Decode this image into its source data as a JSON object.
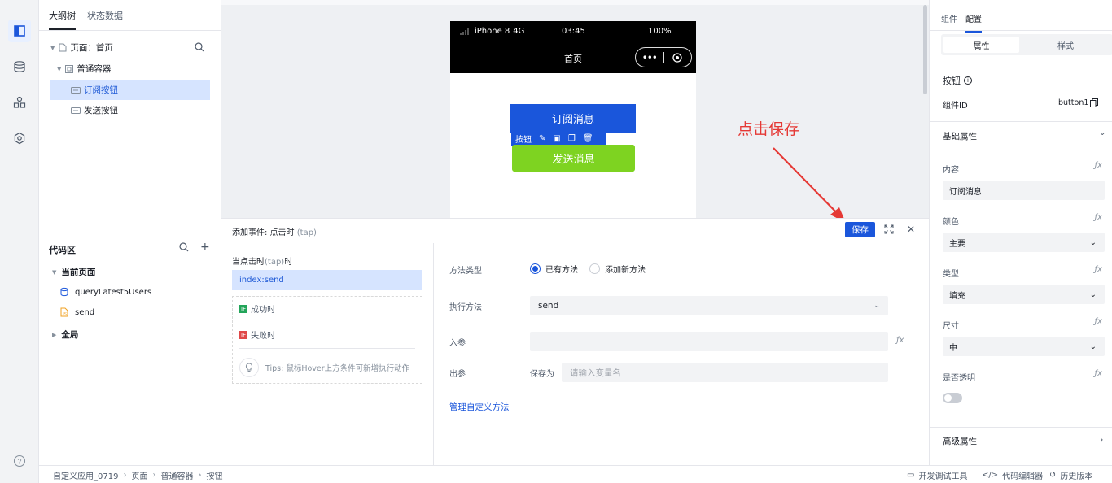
{
  "outline_tabs": [
    "大纲树",
    "状态数据"
  ],
  "tree": {
    "page": "页面：首页",
    "container": "普通容器",
    "button_subscribe": "订阅按钮",
    "button_send": "发送按钮"
  },
  "code_area": {
    "title": "代码区",
    "current_page": "当前页面",
    "items": [
      "queryLatest5Users",
      "send"
    ],
    "global": "全局"
  },
  "phone": {
    "carrier": "iPhone 8",
    "network": "4G",
    "time": "03:45",
    "battery": "100%",
    "title": "首页",
    "btn_subscribe": "订阅消息",
    "btn_send": "发送消息",
    "toolbar_label": "按钮"
  },
  "annotation": "点击保存",
  "event_bar": {
    "title_prefix": "添加事件: 点击时",
    "title_suffix": "(tap)",
    "save": "保存"
  },
  "event_left": {
    "trigger_prefix": "当点击时",
    "trigger_tap": "(tap)",
    "trigger_suffix": "时",
    "action": "index:send",
    "success_tag": "IF",
    "success": "成功时",
    "fail_tag": "IF",
    "fail": "失败时",
    "tips": "Tips: 鼠标Hover上方条件可新增执行动作"
  },
  "event_right": {
    "method_type_label": "方法类型",
    "method_existing": "已有方法",
    "method_new": "添加新方法",
    "exec_label": "执行方法",
    "exec_value": "send",
    "input_label": "入参",
    "output_label": "出参",
    "save_as": "保存为",
    "var_placeholder": "请输入变量名",
    "manage_link": "管理自定义方法"
  },
  "right_panel": {
    "tabs": [
      "组件",
      "配置"
    ],
    "segment": [
      "属性",
      "样式"
    ],
    "comp_name": "按钮",
    "comp_id_label": "组件ID",
    "comp_id_value": "button1",
    "basic_props": "基础属性",
    "content_label": "内容",
    "content_value": "订阅消息",
    "color_label": "颜色",
    "color_value": "主要",
    "type_label": "类型",
    "type_value": "填充",
    "size_label": "尺寸",
    "size_value": "中",
    "transparent_label": "是否透明",
    "transparent_on": false,
    "advanced": "高级属性"
  },
  "breadcrumb": [
    "自定义应用_0719",
    "页面",
    "普通容器",
    "按钮"
  ],
  "status_actions": [
    "开发调试工具",
    "代码编辑器",
    "历史版本"
  ],
  "colors": {
    "primary": "#1a56db",
    "green": "#7ed321",
    "annotation": "#e53935"
  }
}
